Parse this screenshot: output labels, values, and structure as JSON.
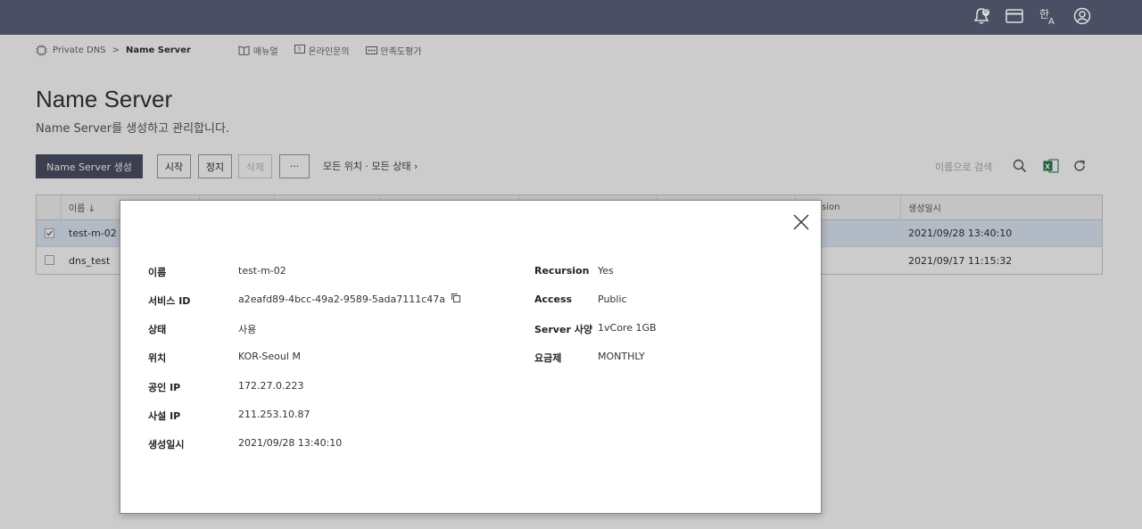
{
  "topbar": {
    "notification_count": "0",
    "icons": [
      "bell-icon",
      "card-icon",
      "language-icon",
      "user-icon"
    ]
  },
  "breadcrumb": {
    "root": "Private DNS",
    "separator": ">",
    "current": "Name Server",
    "links": [
      {
        "label": "매뉴얼",
        "icon": "book-icon"
      },
      {
        "label": "온라인문의",
        "icon": "question-icon"
      },
      {
        "label": "만족도평가",
        "icon": "rating-icon"
      }
    ]
  },
  "page": {
    "title": "Name Server",
    "description": "Name Server를 생성하고 관리합니다."
  },
  "toolbar": {
    "create_label": "Name Server 생성",
    "start_label": "시작",
    "stop_label": "정지",
    "delete_label": "삭제",
    "more_label": "···",
    "filter_label": "모든 위치 · 모든 상태 ›",
    "search_placeholder": "이름으로 검색"
  },
  "table": {
    "headers": {
      "name": "이름 ↓",
      "recursion": "sion",
      "created": "생성일시"
    },
    "rows": [
      {
        "name": "test-m-02",
        "created": "2021/09/28 13:40:10",
        "selected": true
      },
      {
        "name": "dns_test",
        "created": "2021/09/17 11:15:32",
        "selected": false
      }
    ]
  },
  "modal": {
    "left": [
      {
        "key": "이름",
        "value": "test-m-02"
      },
      {
        "key": "서비스 ID",
        "value": "a2eafd89-4bcc-49a2-9589-5ada7111c47a"
      },
      {
        "key": "상태",
        "value": "사용"
      },
      {
        "key": "위치",
        "value": "KOR-Seoul M"
      },
      {
        "key": "공인 IP",
        "value": "172.27.0.223"
      },
      {
        "key": "사설 IP",
        "value": "211.253.10.87"
      },
      {
        "key": "생성일시",
        "value": "2021/09/28 13:40:10"
      }
    ],
    "right": [
      {
        "key": "Recursion",
        "value": "Yes"
      },
      {
        "key": "Access",
        "value": "Public"
      },
      {
        "key": "Server 사양",
        "value": "1vCore 1GB"
      },
      {
        "key": "요금제",
        "value": "MONTHLY"
      }
    ]
  },
  "colors": {
    "topbar": "#4a4f63",
    "selected_row": "#dfe9f7",
    "excel": "#1f7a45"
  }
}
